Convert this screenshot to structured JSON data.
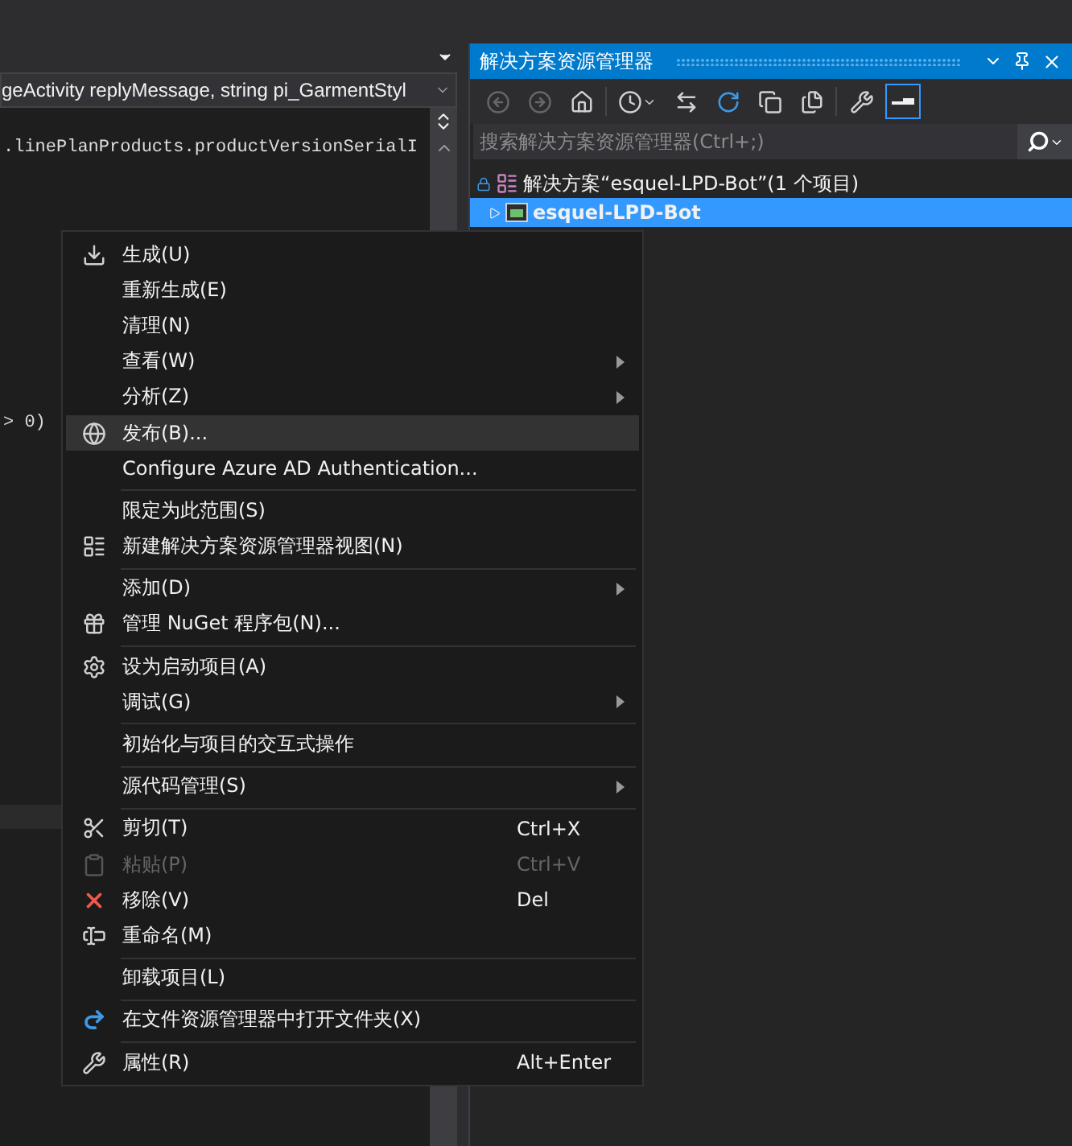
{
  "editor": {
    "member_dropdown": "geActivity replyMessage, string pi_GarmentStyl",
    "code_lines": [
      ".linePlanProducts.productVersionSerialI",
      "> 0)"
    ]
  },
  "solution_explorer": {
    "title": "解决方案资源管理器",
    "toolbar": [
      {
        "kind": "back",
        "disabled": true,
        "selected": false
      },
      {
        "kind": "forward",
        "disabled": true,
        "selected": false
      },
      {
        "kind": "home",
        "disabled": false,
        "selected": false
      },
      {
        "kind": "history",
        "disabled": false,
        "selected": false
      },
      {
        "kind": "sync",
        "disabled": false,
        "selected": false
      },
      {
        "kind": "refresh",
        "disabled": false,
        "selected": false
      },
      {
        "kind": "collapse",
        "disabled": false,
        "selected": false
      },
      {
        "kind": "show_all",
        "disabled": false,
        "selected": false
      },
      {
        "kind": "properties",
        "disabled": false,
        "selected": false
      },
      {
        "kind": "preview",
        "disabled": false,
        "selected": true
      }
    ],
    "search": {
      "placeholder": "搜索解决方案资源管理器(Ctrl+;)"
    },
    "tree": [
      {
        "label": "解决方案“esquel-LPD-Bot”(1 个项目)",
        "kind": "solution",
        "selected": false,
        "expanded": true,
        "children": [
          {
            "label": "esquel-LPD-Bot",
            "kind": "project",
            "selected": true
          }
        ]
      }
    ]
  },
  "context_menu": {
    "items": [
      {
        "kind": "build",
        "label": "生成(U)",
        "selected": false,
        "disabled": false,
        "submenu": false
      },
      {
        "kind": "plain",
        "label": "重新生成(E)",
        "selected": false,
        "disabled": false,
        "submenu": false
      },
      {
        "kind": "plain",
        "label": "清理(N)",
        "selected": false,
        "disabled": false,
        "submenu": false
      },
      {
        "kind": "plain",
        "label": "查看(W)",
        "selected": false,
        "disabled": false,
        "submenu": true
      },
      {
        "kind": "plain",
        "label": "分析(Z)",
        "selected": false,
        "disabled": false,
        "submenu": true
      },
      {
        "kind": "publish",
        "label": "发布(B)...",
        "selected": true,
        "disabled": false,
        "submenu": false
      },
      {
        "kind": "plain",
        "label": "Configure Azure AD Authentication...",
        "selected": false,
        "disabled": false,
        "submenu": false
      },
      {
        "kind": "separator"
      },
      {
        "kind": "plain",
        "label": "限定为此范围(S)",
        "selected": false,
        "disabled": false,
        "submenu": false
      },
      {
        "kind": "view",
        "label": "新建解决方案资源管理器视图(N)",
        "selected": false,
        "disabled": false,
        "submenu": false
      },
      {
        "kind": "separator"
      },
      {
        "kind": "plain",
        "label": "添加(D)",
        "selected": false,
        "disabled": false,
        "submenu": true
      },
      {
        "kind": "package",
        "label": "管理 NuGet 程序包(N)...",
        "selected": false,
        "disabled": false,
        "submenu": false
      },
      {
        "kind": "separator"
      },
      {
        "kind": "startup",
        "label": "设为启动项目(A)",
        "selected": false,
        "disabled": false,
        "submenu": false
      },
      {
        "kind": "plain",
        "label": "调试(G)",
        "selected": false,
        "disabled": false,
        "submenu": true
      },
      {
        "kind": "separator"
      },
      {
        "kind": "plain",
        "label": "初始化与项目的交互式操作",
        "selected": false,
        "disabled": false,
        "submenu": false
      },
      {
        "kind": "separator"
      },
      {
        "kind": "plain",
        "label": "源代码管理(S)",
        "selected": false,
        "disabled": false,
        "submenu": true
      },
      {
        "kind": "separator"
      },
      {
        "kind": "cut",
        "label": "剪切(T)",
        "shortcut": "Ctrl+X",
        "selected": false,
        "disabled": false,
        "submenu": false
      },
      {
        "kind": "paste",
        "label": "粘贴(P)",
        "shortcut": "Ctrl+V",
        "selected": false,
        "disabled": true,
        "submenu": false
      },
      {
        "kind": "remove",
        "label": "移除(V)",
        "shortcut": "Del",
        "selected": false,
        "disabled": false,
        "submenu": false
      },
      {
        "kind": "rename",
        "label": "重命名(M)",
        "selected": false,
        "disabled": false,
        "submenu": false
      },
      {
        "kind": "separator"
      },
      {
        "kind": "plain",
        "label": "卸载项目(L)",
        "selected": false,
        "disabled": false,
        "submenu": false
      },
      {
        "kind": "separator"
      },
      {
        "kind": "folder",
        "label": "在文件资源管理器中打开文件夹(X)",
        "selected": false,
        "disabled": false,
        "submenu": false
      },
      {
        "kind": "separator"
      },
      {
        "kind": "properties",
        "label": "属性(R)",
        "shortcut": "Alt+Enter",
        "selected": false,
        "disabled": false,
        "submenu": false
      }
    ]
  }
}
